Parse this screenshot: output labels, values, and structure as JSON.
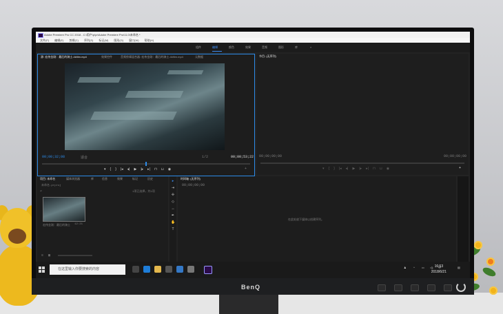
{
  "window": {
    "title": "Adobe Premiere Pro CC 2018 - C:\\用户\\p\\pr\\Adobe Premiere Pro\\11.0\\未命名 *",
    "menu": [
      "文件(F)",
      "编辑(E)",
      "剪辑(C)",
      "序列(S)",
      "标记(M)",
      "图形(G)",
      "窗口(W)",
      "帮助(H)"
    ]
  },
  "workspaces": [
    "组件",
    "编辑",
    "颜色",
    "效果",
    "音频",
    "图形",
    "库"
  ],
  "source_panel": {
    "tabs": [
      "源: 宏伟金刚：最后的骑士-4kfilm.mp4",
      "效果控件",
      "音频剪辑混合器: 宏伟金刚：最后的骑士-4kfilm.mp4",
      "元数据"
    ],
    "timecode_in": "00;00;32;08",
    "fit": "适合",
    "ratio": "1/2",
    "timecode_out": "00;00;53;22"
  },
  "program_panel": {
    "tab": "节目: (无序列)",
    "timecode_left": "00;00;00;00",
    "timecode_right": "00;00;00;00"
  },
  "project_panel": {
    "tabs": [
      "项目: 未命名",
      "媒体浏览器",
      "库",
      "信息",
      "效果",
      "标记",
      "历史"
    ],
    "file": "未命名.prproj",
    "count": "1项已选择，共1项",
    "clip_name": "宏伟金刚：最后的骑士",
    "clip_duration": "12:21"
  },
  "timeline_panel": {
    "tab": "时间轴: (无序列)",
    "timecode": "00;00;00;00",
    "hint": "在此处放下媒体以创建序列。"
  },
  "taskbar": {
    "search_placeholder": "在这里输入你要搜索的内容",
    "time": "16:53",
    "date": "2018/6/21"
  },
  "monitor": {
    "brand": "BenQ"
  }
}
